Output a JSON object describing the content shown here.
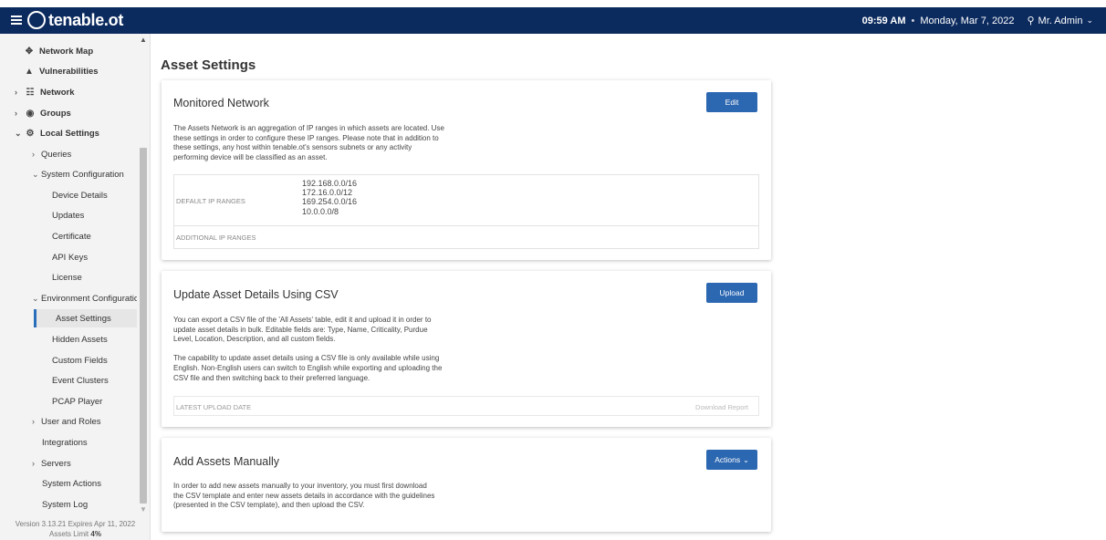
{
  "header": {
    "app_name": "tenable.ot",
    "time": "09:59 AM",
    "separator": "•",
    "date": "Monday, Mar 7, 2022",
    "user": "Mr. Admin",
    "colors": {
      "header_bg": "#0b2a5e",
      "accent": "#2c67b1"
    }
  },
  "sidebar": {
    "items": [
      {
        "label": "Network Map",
        "icon": "network-map-icon"
      },
      {
        "label": "Vulnerabilities",
        "icon": "vulnerabilities-icon"
      },
      {
        "label": "Network",
        "icon": "network-icon",
        "arrow": ">"
      },
      {
        "label": "Groups",
        "icon": "groups-icon",
        "arrow": ">"
      },
      {
        "label": "Local Settings",
        "icon": "settings-icon",
        "arrow": "v"
      },
      {
        "label": "Queries",
        "arrow": ">"
      },
      {
        "label": "System Configuration",
        "arrow": "v"
      },
      {
        "label": "Device Details"
      },
      {
        "label": "Updates"
      },
      {
        "label": "Certificate"
      },
      {
        "label": "API Keys"
      },
      {
        "label": "License"
      },
      {
        "label": "Environment Configuration",
        "arrow": "v"
      },
      {
        "label": "Asset Settings",
        "active": true
      },
      {
        "label": "Hidden Assets"
      },
      {
        "label": "Custom Fields"
      },
      {
        "label": "Event Clusters"
      },
      {
        "label": "PCAP Player"
      },
      {
        "label": "User and Roles",
        "arrow": ">"
      },
      {
        "label": "Integrations"
      },
      {
        "label": "Servers",
        "arrow": ">"
      },
      {
        "label": "System Actions"
      },
      {
        "label": "System Log"
      }
    ],
    "version_text": "Version 3.13.21 Expires Apr 11, 2022",
    "assets_limit_label": "Assets Limit",
    "assets_limit_value": "4%"
  },
  "main": {
    "page_title": "Asset Settings",
    "monitored": {
      "title": "Monitored Network",
      "button": "Edit",
      "description": [
        "The Assets Network is an aggregation of IP ranges in which assets are located. Use",
        "these settings in order to configure these IP ranges. Please note that in addition to",
        "these settings, any host within tenable.ot's sensors subnets or any activity",
        "performing device will be classified as an asset."
      ],
      "default_label": "DEFAULT IP RANGES",
      "default_ranges": [
        "192.168.0.0/16",
        "172.16.0.0/12",
        "169.254.0.0/16",
        "10.0.0.0/8"
      ],
      "additional_label": "ADDITIONAL IP RANGES"
    },
    "csv": {
      "title": "Update Asset Details Using CSV",
      "button": "Upload",
      "description": [
        "You can export a CSV file of the 'All Assets' table, edit it and upload it in order to",
        "update asset details in bulk. Editable fields are: Type, Name, Criticality, Purdue",
        "Level, Location, Description, and all custom fields.",
        "",
        "The capability to update asset details using a CSV file is only available while using",
        "English. Non-English users can switch to English while exporting and uploading the",
        "CSV file and then switching back to their preferred language."
      ],
      "upload_label": "LATEST UPLOAD DATE",
      "download_link": "Download Report"
    },
    "manual": {
      "title": "Add Assets Manually",
      "button": "Actions",
      "description": [
        "In order to add new assets manually to your inventory, you must first download",
        "the CSV template and enter new assets details in accordance with the guidelines",
        "(presented in the CSV template), and then upload the CSV."
      ]
    }
  }
}
